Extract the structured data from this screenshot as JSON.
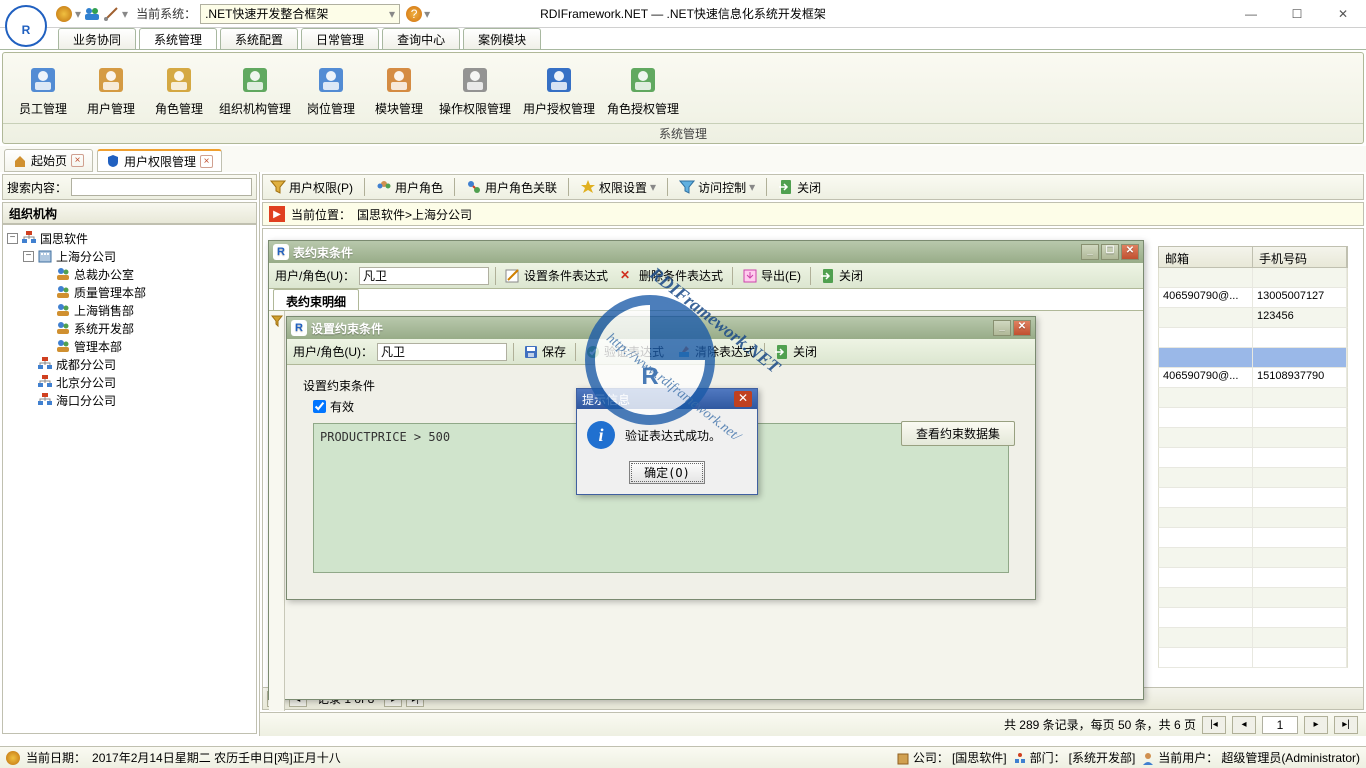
{
  "app": {
    "title": "RDIFramework.NET — .NET快速信息化系统开发框架",
    "current_sys_label": "当前系统：",
    "current_sys_value": ".NET快速开发整合框架"
  },
  "maintabs": [
    "业务协同",
    "系统管理",
    "系统配置",
    "日常管理",
    "查询中心",
    "案例模块"
  ],
  "maintab_active": 1,
  "ribbon": {
    "group": "系统管理",
    "items": [
      "员工管理",
      "用户管理",
      "角色管理",
      "组织机构管理",
      "岗位管理",
      "模块管理",
      "操作权限管理",
      "用户授权管理",
      "角色授权管理"
    ]
  },
  "doctabs": [
    {
      "label": "起始页",
      "icon": "home"
    },
    {
      "label": "用户权限管理",
      "icon": "shield"
    }
  ],
  "doctab_active": 1,
  "search_label": "搜索内容：",
  "org_header": "组织机构",
  "tree": {
    "root": "国思软件",
    "l1": "上海分公司",
    "l2": [
      "总裁办公室",
      "质量管理本部",
      "上海销售部",
      "系统开发部",
      "管理本部"
    ],
    "siblings": [
      "成都分公司",
      "北京分公司",
      "海口分公司"
    ]
  },
  "toolbar2": [
    {
      "k": "perm",
      "label": "用户权限(P)"
    },
    {
      "k": "role",
      "label": "用户角色"
    },
    {
      "k": "rolerel",
      "label": "用户角色关联"
    },
    {
      "k": "permcfg",
      "label": "权限设置"
    },
    {
      "k": "access",
      "label": "访问控制"
    },
    {
      "k": "close",
      "label": "关闭"
    }
  ],
  "loc": {
    "label": "当前位置：",
    "path": "国思软件>上海分公司"
  },
  "grid": {
    "cols": [
      "邮箱",
      "手机号码"
    ],
    "rows": [
      {
        "email": "",
        "phone": ""
      },
      {
        "email": "406590790@...",
        "phone": "13005007127"
      },
      {
        "email": "",
        "phone": "123456"
      },
      {
        "email": "",
        "phone": ""
      },
      {
        "email": "",
        "phone": ""
      },
      {
        "email": "406590790@...",
        "phone": "15108937790"
      },
      {
        "email": "",
        "phone": ""
      }
    ],
    "nav": "记录 1 of 8"
  },
  "pager": {
    "summary": "共 289 条记录，每页 50 条，共 6 页",
    "page": "1"
  },
  "dlg1": {
    "title": "表约束条件",
    "user_label": "用户/角色(U)：",
    "user_value": "凡卫",
    "btns": [
      "设置条件表达式",
      "删除条件表达式",
      "导出(E)",
      "关闭"
    ],
    "tab": "表约束明细"
  },
  "dlg2": {
    "title": "设置约束条件",
    "user_label": "用户/角色(U)：",
    "user_value": "凡卫",
    "btns": [
      "保存",
      "验证表达式",
      "清除表达式",
      "关闭"
    ],
    "section": "设置约束条件",
    "chk": "有效",
    "expr": "PRODUCTPRICE > 500",
    "viewbtn": "查看约束数据集"
  },
  "msg": {
    "title": "提示信息",
    "text": "验证表达式成功。",
    "ok": "确定(O)"
  },
  "status": {
    "date_label": "当前日期：",
    "date": "2017年2月14日星期二  农历壬申日[鸡]正月十八",
    "company_lbl": "公司：",
    "company": "[国思软件]",
    "dept_lbl": "部门：",
    "dept": "[系统开发部]",
    "user_lbl": "当前用户：",
    "user": "超级管理员(Administrator)"
  },
  "watermark": {
    "text": "RDIFramework.NET",
    "url": "http://www.rdiframework.net/"
  }
}
